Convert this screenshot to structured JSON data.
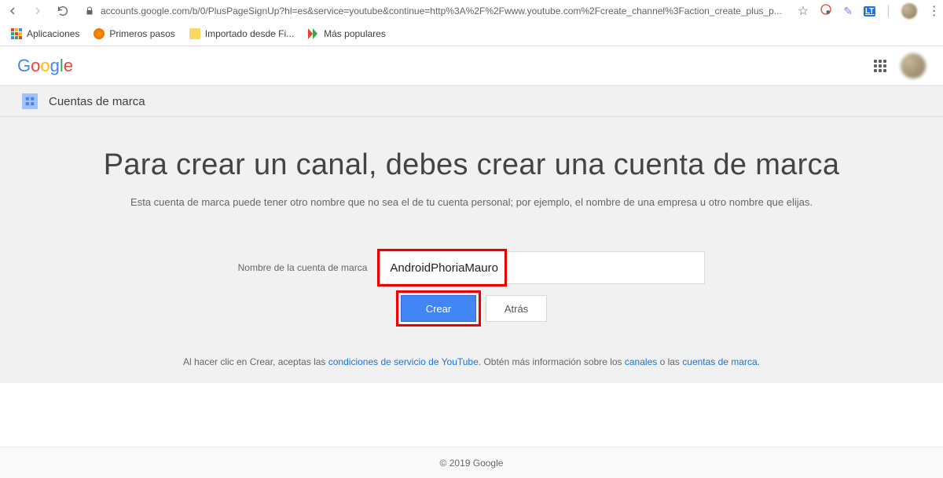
{
  "url": "accounts.google.com/b/0/PlusPageSignUp?hl=es&service=youtube&continue=http%3A%2F%2Fwww.youtube.com%2Fcreate_channel%3Faction_create_plus_p...",
  "bookmarks": {
    "apps": "Aplicaciones",
    "first_steps": "Primeros pasos",
    "imported": "Importado desde Fi...",
    "popular": "Más populares"
  },
  "header": {
    "logo": "Google"
  },
  "subheader": {
    "title": "Cuentas de marca"
  },
  "main": {
    "headline": "Para crear un canal, debes crear una cuenta de marca",
    "subtext": "Esta cuenta de marca puede tener otro nombre que no sea el de tu cuenta personal; por ejemplo, el nombre de una empresa u otro nombre que elijas.",
    "field_label": "Nombre de la cuenta de marca",
    "input_value": "AndroidPhoriaMauro",
    "create_btn": "Crear",
    "back_btn": "Atrás",
    "disclaimer_prefix": "Al hacer clic en Crear, aceptas las ",
    "terms_link": "condiciones de servicio de YouTube",
    "disclaimer_mid": ". Obtén más información sobre los ",
    "channels_link": "canales",
    "or": " o las ",
    "brand_link": "cuentas de marca",
    "period": "."
  },
  "footer": "© 2019 Google",
  "ext_lt": "LT"
}
